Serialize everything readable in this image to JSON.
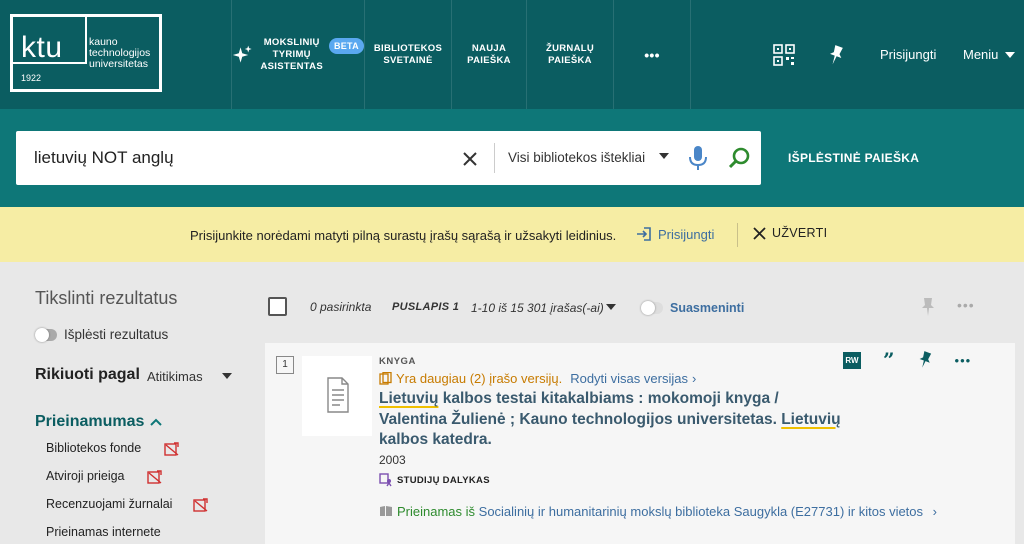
{
  "logo": {
    "mark": "ktu",
    "year": "1922",
    "name_lines": [
      "kauno",
      "technologijos",
      "universitetas"
    ]
  },
  "nav": {
    "assistant_lines": [
      "MOKSLINIŲ",
      "TYRIMŲ",
      "ASISTENTAS"
    ],
    "beta": "BETA",
    "library_sites_lines": [
      "BIBLIOTEKOS",
      "SVETAINĖ"
    ],
    "new_search_lines": [
      "NAUJA",
      "PAIEŠKA"
    ],
    "journal_search_lines": [
      "ŽURNALŲ",
      "PAIEŠKA"
    ],
    "more": "•••",
    "login": "Prisijungti",
    "menu": "Meniu"
  },
  "search": {
    "query": "lietuvių NOT anglų",
    "scope": "Visi bibliotekos ištekliai",
    "advanced": "IŠPLĖSTINĖ PAIEŠKA"
  },
  "notice": {
    "message": "Prisijunkite norėdami matyti pilną surastų įrašų sąrašą ir užsakyti leidinius.",
    "login": "Prisijungti",
    "dismiss": "UŽVERTI"
  },
  "sidebar": {
    "title": "Tikslinti rezultatus",
    "expand_results": "Išplėsti rezultatus",
    "sort_label": "Rikiuoti pagal",
    "sort_value": "Atitikimas",
    "availability_heading": "Prieinamumas",
    "facets": [
      {
        "label": "Bibliotekos fonde"
      },
      {
        "label": "Atviroji prieiga"
      },
      {
        "label": "Recenzuojami žurnalai"
      },
      {
        "label": "Prieinamas internete"
      }
    ]
  },
  "results_header": {
    "selected": "0 pasirinkta",
    "page": "PUSLAPIS 1",
    "range": "1-10 iš 15 301 įrašas(-ai)",
    "personalize": "Suasmeninti"
  },
  "result": {
    "index": "1",
    "type": "KNYGA",
    "versions_text": "Yra daugiau (2) įrašo versijų.",
    "view_all_versions": "Rodyti visas versijas",
    "title_parts": {
      "hl1": "Lietuvių",
      "mid1": " kalbos testai kitakalbiams : mokomoji knyga / Valentina Žulienė ; Kauno technologijos universitetas. ",
      "hl2": "Lietuvių",
      "end": " kalbos katedra."
    },
    "year": "2003",
    "course": "STUDIJŲ DALYKAS",
    "availability_status": "Prieinamas iš",
    "availability_location": " Socialinių ir humanitarinių mokslų biblioteka  Saugykla (E27731) ir kitos vietos"
  },
  "colors": {
    "primary": "#0b5d61",
    "search_band": "#0e7778",
    "notice": "#f6eda4",
    "link": "#3d6ea0",
    "highlight": "#f0c000"
  }
}
